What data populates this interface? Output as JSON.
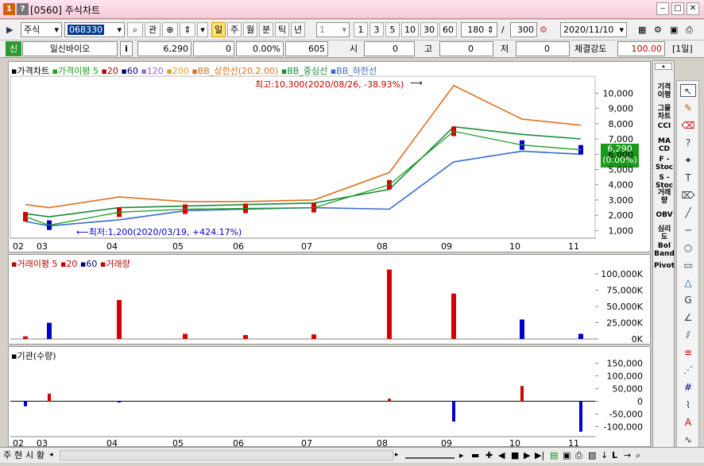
{
  "window": {
    "number": "[0560]",
    "title": "주식차트",
    "icons": [
      "1",
      "?"
    ]
  },
  "toolbar": {
    "market": "주식",
    "code": "068330",
    "btn_gwan": "관",
    "periods": [
      "일",
      "주",
      "월",
      "분",
      "틱",
      "년"
    ],
    "period_count": "1",
    "minute_options": [
      "1",
      "3",
      "5",
      "10",
      "30",
      "60"
    ],
    "count": "180",
    "slash": "/",
    "total": "300",
    "date": "2020/11/10"
  },
  "info": {
    "badge": "신",
    "name": "일신바이오",
    "i": "i",
    "price": "6,290",
    "change": "0",
    "rate": "0.00%",
    "volume": "605",
    "open_label": "시",
    "open_value": "0",
    "high_label": "고",
    "high_value": "0",
    "low_label": "저",
    "low_value": "0",
    "strength_label": "체결강도",
    "strength_value": "100.00",
    "period_badge": "[1일]"
  },
  "price_panel": {
    "legend": {
      "main": "가격차트",
      "ma": "가격이평 5",
      "ma20": "20",
      "ma60": "60",
      "ma120": "120",
      "ma200": "200",
      "bb_up": "BB_상한선(20,2.00)",
      "bb_mid": "BB_중심선",
      "bb_low": "BB_하한선"
    },
    "annotation_high": "최고:10,300(2020/08/26, -38.93%)",
    "annotation_low": "최저:1,200(2020/03/19, +424.17%)",
    "current_price": "6,290",
    "current_rate": "(0.00%)",
    "y_ticks": [
      "10,000",
      "9,000",
      "8,000",
      "7,000",
      "6,000",
      "5,000",
      "4,000",
      "3,000",
      "2,000",
      "1,000"
    ]
  },
  "volume_panel": {
    "legend": {
      "ma": "거래이평 5",
      "ma20": "20",
      "ma60": "60",
      "vol": "거래량"
    },
    "y_ticks": [
      "100,000K",
      "75,000K",
      "50,000K",
      "25,000K",
      "0K"
    ]
  },
  "inst_panel": {
    "legend": "기관(수량)",
    "y_ticks": [
      "150,000",
      "100,000",
      "50,000",
      "0",
      "-50,000",
      "-100,000"
    ]
  },
  "x_ticks": [
    "02",
    "03",
    "04",
    "05",
    "06",
    "07",
    "08",
    "09",
    "10",
    "11"
  ],
  "right_indicators": [
    "기격\n이평",
    "그물\n차트",
    "CCI",
    "MA\nCD",
    "F -\nStoc",
    "S -\nStoc",
    "거래\n량",
    "OBV",
    "심리\n도",
    "Bol\nBand",
    "Pivot"
  ],
  "bottom_tabs": [
    "주",
    "현",
    "시",
    "황"
  ],
  "colors": {
    "up": "#d40000",
    "down": "#0000c8",
    "ma5": "#1e9e1e",
    "ma20": "#c00000",
    "ma60": "#000080",
    "ma120": "#a060e0",
    "ma200": "#e0a020",
    "bb_up": "#e07020",
    "bb_mid": "#1a8a3a",
    "bb_low": "#3a6ad0",
    "accent": "#1a9a1a"
  },
  "chart_data": [
    {
      "type": "candlestick",
      "title": "가격차트",
      "x": [
        "2020-02",
        "2020-03",
        "2020-04",
        "2020-05",
        "2020-06",
        "2020-07",
        "2020-08",
        "2020-09",
        "2020-10",
        "2020-11"
      ],
      "close": [
        1900,
        1350,
        2200,
        2400,
        2450,
        2500,
        4000,
        7500,
        6600,
        6290
      ],
      "ylim": [
        500,
        10800
      ],
      "annotations": [
        "최고:10,300(2020/08/26, -38.93%)",
        "최저:1,200(2020/03/19, +424.17%)"
      ],
      "series": [
        {
          "name": "BB_상한선(20,2.00)",
          "values": [
            2700,
            2500,
            3200,
            2900,
            2900,
            3000,
            4800,
            10500,
            8300,
            7900
          ]
        },
        {
          "name": "BB_중심선",
          "values": [
            2100,
            1900,
            2500,
            2600,
            2700,
            2800,
            3700,
            7800,
            7300,
            7000
          ]
        },
        {
          "name": "BB_하한선",
          "values": [
            1600,
            1300,
            1700,
            2300,
            2400,
            2500,
            2400,
            5500,
            6200,
            6000
          ]
        }
      ]
    },
    {
      "type": "bar",
      "title": "거래량",
      "x": [
        "2020-02",
        "2020-03",
        "2020-04",
        "2020-05",
        "2020-06",
        "2020-07",
        "2020-08",
        "2020-09",
        "2020-10",
        "2020-11"
      ],
      "values": [
        4000,
        25000,
        60000,
        8000,
        6000,
        7000,
        107000,
        70000,
        30000,
        8000
      ],
      "ylim": [
        0,
        110000
      ]
    },
    {
      "type": "bar",
      "title": "기관(수량)",
      "x": [
        "2020-02",
        "2020-03",
        "2020-04",
        "2020-05",
        "2020-06",
        "2020-07",
        "2020-08",
        "2020-09",
        "2020-10",
        "2020-11"
      ],
      "values": [
        -20000,
        30000,
        -5000,
        0,
        0,
        0,
        10000,
        -80000,
        60000,
        -120000
      ],
      "ylim": [
        -130000,
        170000
      ]
    }
  ]
}
